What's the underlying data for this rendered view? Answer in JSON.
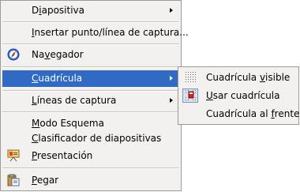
{
  "menu": {
    "items": [
      {
        "pre": "D",
        "key": "i",
        "post": "apositiva"
      },
      {
        "pre": "",
        "key": "I",
        "post": "nsertar punto/línea de captura..."
      },
      {
        "pre": "Na",
        "key": "v",
        "post": "egador"
      },
      {
        "pre": "",
        "key": "C",
        "post": "uadrícula"
      },
      {
        "pre": "",
        "key": "L",
        "post": "íneas de captura"
      },
      {
        "pre": "",
        "key": "M",
        "post": "odo Esquema"
      },
      {
        "pre": "",
        "key": "C",
        "post": "lasificador de diapositivas"
      },
      {
        "pre": "",
        "key": "P",
        "post": "resentación"
      },
      {
        "pre": "",
        "key": "P",
        "post": "egar"
      }
    ]
  },
  "submenu": {
    "items": [
      {
        "pre": "Cuadrícula ",
        "key": "v",
        "post": "isible"
      },
      {
        "pre": "",
        "key": "U",
        "post": "sar cuadrícula"
      },
      {
        "pre": "Cuadrícula al ",
        "key": "f",
        "post": "rente"
      }
    ]
  },
  "colors": {
    "highlight": "#316ac5",
    "menu_bg": "#f2f1ef",
    "border": "#9c9a94"
  },
  "icons": [
    "navigator-icon",
    "presentation-icon",
    "paste-icon",
    "grid-dots-icon",
    "snap-grid-icon"
  ]
}
